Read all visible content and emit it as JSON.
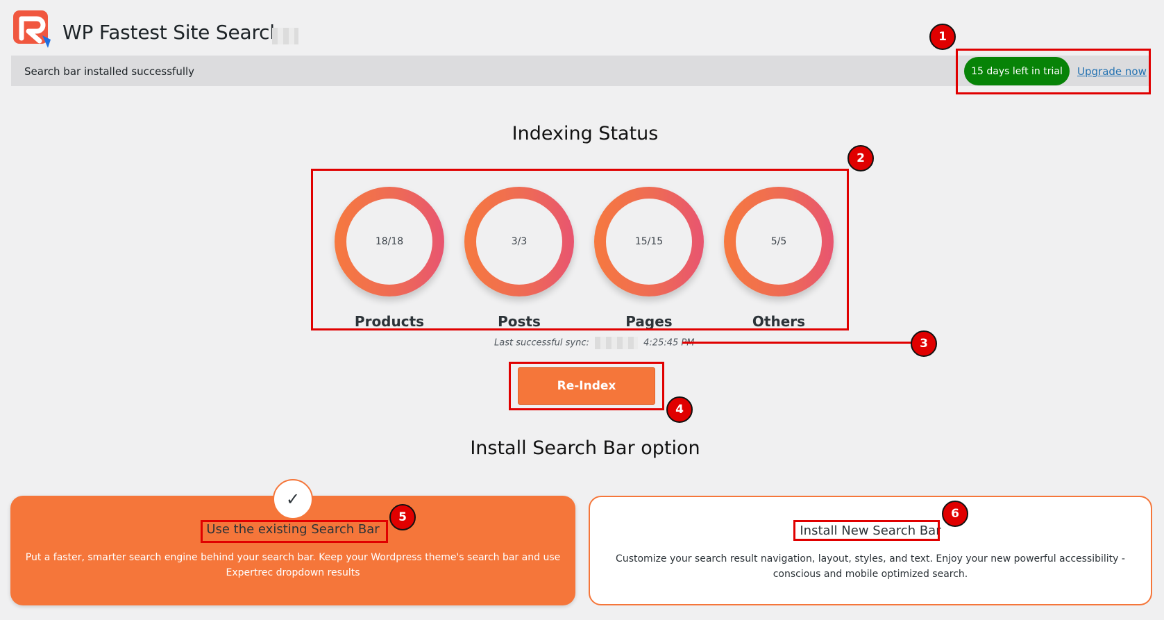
{
  "header": {
    "logo_icon": "expertrec-logo-icon",
    "title": "WP Fastest Site Search"
  },
  "notice": {
    "message": "Search bar installed successfully",
    "trial_badge": "15 days left in trial",
    "upgrade_link": "Upgrade now"
  },
  "indexing": {
    "heading": "Indexing Status",
    "rings": [
      {
        "label": "Products",
        "count": "18/18"
      },
      {
        "label": "Posts",
        "count": "3/3"
      },
      {
        "label": "Pages",
        "count": "15/15"
      },
      {
        "label": "Others",
        "count": "5/5"
      }
    ],
    "sync_label": "Last successful sync:",
    "sync_time": "4:25:45 PM",
    "reindex_button": "Re-Index"
  },
  "install": {
    "heading": "Install Search Bar option",
    "existing": {
      "title": "Use the existing Search Bar",
      "description": "Put a faster, smarter search engine behind your search bar. Keep your Wordpress theme's search bar and use Expertrec dropdown results",
      "check_icon": "checkmark-icon",
      "check_glyph": "✓"
    },
    "new": {
      "title": "Install New Search Bar",
      "description": "Customize your search result navigation, layout, styles, and text. Enjoy your new powerful accessibility - conscious and mobile optimized search."
    }
  },
  "annotations": {
    "markers": [
      "1",
      "2",
      "3",
      "4",
      "5",
      "6"
    ]
  },
  "colors": {
    "accent": "#f5763a",
    "trial_green": "#078307",
    "link_blue": "#2271b1",
    "annotation_red": "#e00000"
  }
}
